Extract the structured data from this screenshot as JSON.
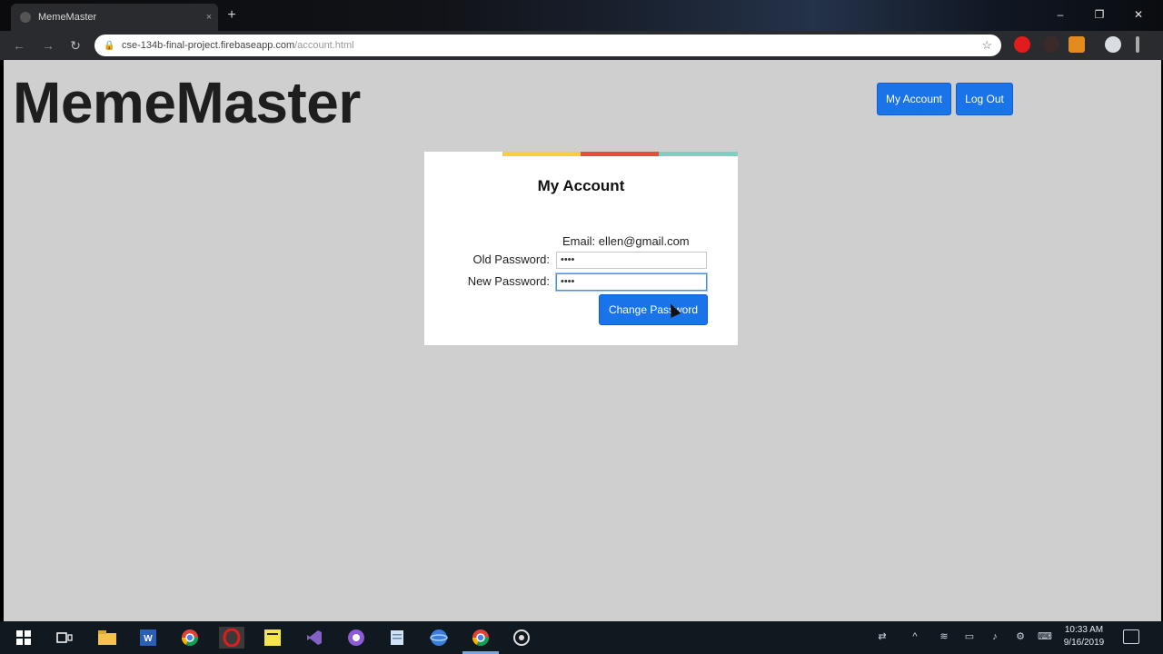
{
  "browser": {
    "tab_title": "MemeMaster",
    "tab_close": "×",
    "new_tab": "+",
    "url_host": "cse-134b-final-project.firebaseapp.com",
    "url_path": "/account.html",
    "window_controls": {
      "minimize": "–",
      "maximize": "❐",
      "close": "✕"
    },
    "nav": {
      "back": "←",
      "forward": "→",
      "reload": "↻"
    }
  },
  "header": {
    "brand": "MemeMaster",
    "my_account_label": "My Account",
    "logout_label": "Log Out"
  },
  "account_card": {
    "title": "My Account",
    "email_text": "Email: ellen@gmail.com",
    "old_password_label": "Old Password:",
    "old_password_value": "••••",
    "new_password_label": "New Password:",
    "new_password_value": "••••",
    "change_button_label": "Change Password",
    "stripe_colors": [
      "#f4d03f",
      "#e74c3c",
      "#7ecfc0"
    ]
  },
  "taskbar": {
    "icons": [
      "windows-start-icon",
      "task-view-icon",
      "file-explorer-icon",
      "word-icon",
      "chrome-icon",
      "opera-icon",
      "sticky-notes-icon",
      "visual-studio-icon",
      "app-icon",
      "notepad-icon",
      "browser-icon",
      "chrome-icon-active",
      "settings-icon"
    ],
    "clock_time": "10:33 AM",
    "clock_date": "9/16/2019"
  },
  "colors": {
    "accent_blue": "#1a73e8",
    "page_bg": "#cfcfcf"
  }
}
